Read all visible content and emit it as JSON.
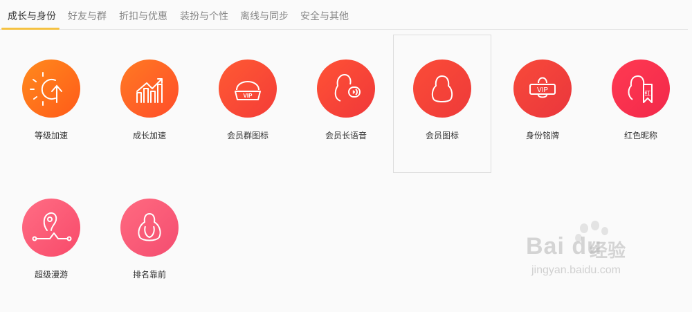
{
  "tabs": [
    {
      "label": "成长与身份",
      "active": true
    },
    {
      "label": "好友与群",
      "active": false
    },
    {
      "label": "折扣与优惠",
      "active": false
    },
    {
      "label": "装扮与个性",
      "active": false
    },
    {
      "label": "离线与同步",
      "active": false
    },
    {
      "label": "安全与其他",
      "active": false
    }
  ],
  "features": [
    {
      "label": "等级加速",
      "icon": "sun-arrow-icon",
      "color_from": "#ff8a1c",
      "color_to": "#ff5a1a"
    },
    {
      "label": "成长加速",
      "icon": "growth-chart-icon",
      "color_from": "#ff7a22",
      "color_to": "#ff4d2a"
    },
    {
      "label": "会员群图标",
      "icon": "vip-penguin-group-icon",
      "color_from": "#ff5a33",
      "color_to": "#f43c38"
    },
    {
      "label": "会员长语音",
      "icon": "penguin-voice-icon",
      "color_from": "#ff5235",
      "color_to": "#f0383a"
    },
    {
      "label": "会员图标",
      "icon": "penguin-icon",
      "color_from": "#fb4c37",
      "color_to": "#ee3a3a",
      "selected": true
    },
    {
      "label": "身份铭牌",
      "icon": "vip-nameplate-icon",
      "color_from": "#f84a3a",
      "color_to": "#ea363c"
    },
    {
      "label": "红色昵称",
      "icon": "penguin-red-name-icon",
      "color_from": "#ff3a52",
      "color_to": "#f2284a"
    },
    {
      "label": "超级漫游",
      "icon": "location-pin-icon",
      "color_from": "#ff6d84",
      "color_to": "#f84a6a"
    },
    {
      "label": "排名靠前",
      "icon": "penguin-outline-icon",
      "color_from": "#ff6a80",
      "color_to": "#f44d70"
    }
  ],
  "watermark": {
    "brand": "Bai du",
    "brand_cn": "经验",
    "url": "jingyan.baidu.com"
  }
}
